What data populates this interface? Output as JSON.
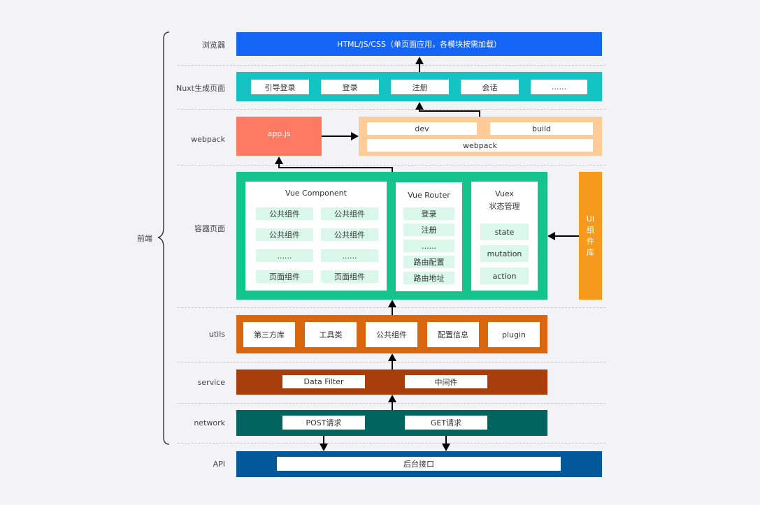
{
  "frontend_label": "前端",
  "rows": {
    "browser": {
      "label": "浏览器",
      "content": "HTML/JS/CSS（单页面应用，各模块按需加载）"
    },
    "nuxt": {
      "label": "Nuxt生成页面",
      "items": [
        "引导登录",
        "登录",
        "注册",
        "会话",
        "......"
      ]
    },
    "webpack": {
      "label": "webpack",
      "appjs": "app.js",
      "dev": "dev",
      "build": "build",
      "webpack": "webpack"
    },
    "container": {
      "label": "容器页面",
      "vue_component": {
        "title": "Vue Component",
        "items": [
          "公共组件",
          "公共组件",
          "公共组件",
          "公共组件",
          "......",
          "......",
          "页面组件",
          "页面组件"
        ]
      },
      "vue_router": {
        "title": "Vue Router",
        "items": [
          "登录",
          "注册",
          "......",
          "路由配置",
          "路由地址"
        ]
      },
      "vuex": {
        "title": "Vuex",
        "subtitle": "状态管理",
        "items": [
          "state",
          "mutation",
          "action"
        ]
      },
      "ui_lib": [
        "UI",
        "组",
        "件",
        "库"
      ]
    },
    "utils": {
      "label": "utils",
      "items": [
        "第三方库",
        "工具类",
        "公共组件",
        "配置信息",
        "plugin"
      ]
    },
    "service": {
      "label": "service",
      "items": [
        "Data Filter",
        "中间件"
      ]
    },
    "network": {
      "label": "network",
      "items": [
        "POST请求",
        "GET请求"
      ]
    },
    "api": {
      "label": "API",
      "content": "后台接口"
    }
  },
  "colors": {
    "browser": "#1464f5",
    "nuxt": "#14c4c4",
    "appjs": "#ff7a62",
    "webpack_panel": "#ffcc99",
    "container": "#14c48c",
    "ui_lib": "#f59a1c",
    "utils": "#d8670f",
    "service": "#a83e0a",
    "network": "#02645e",
    "api": "#02589a",
    "tile": "#d9f8ea"
  }
}
